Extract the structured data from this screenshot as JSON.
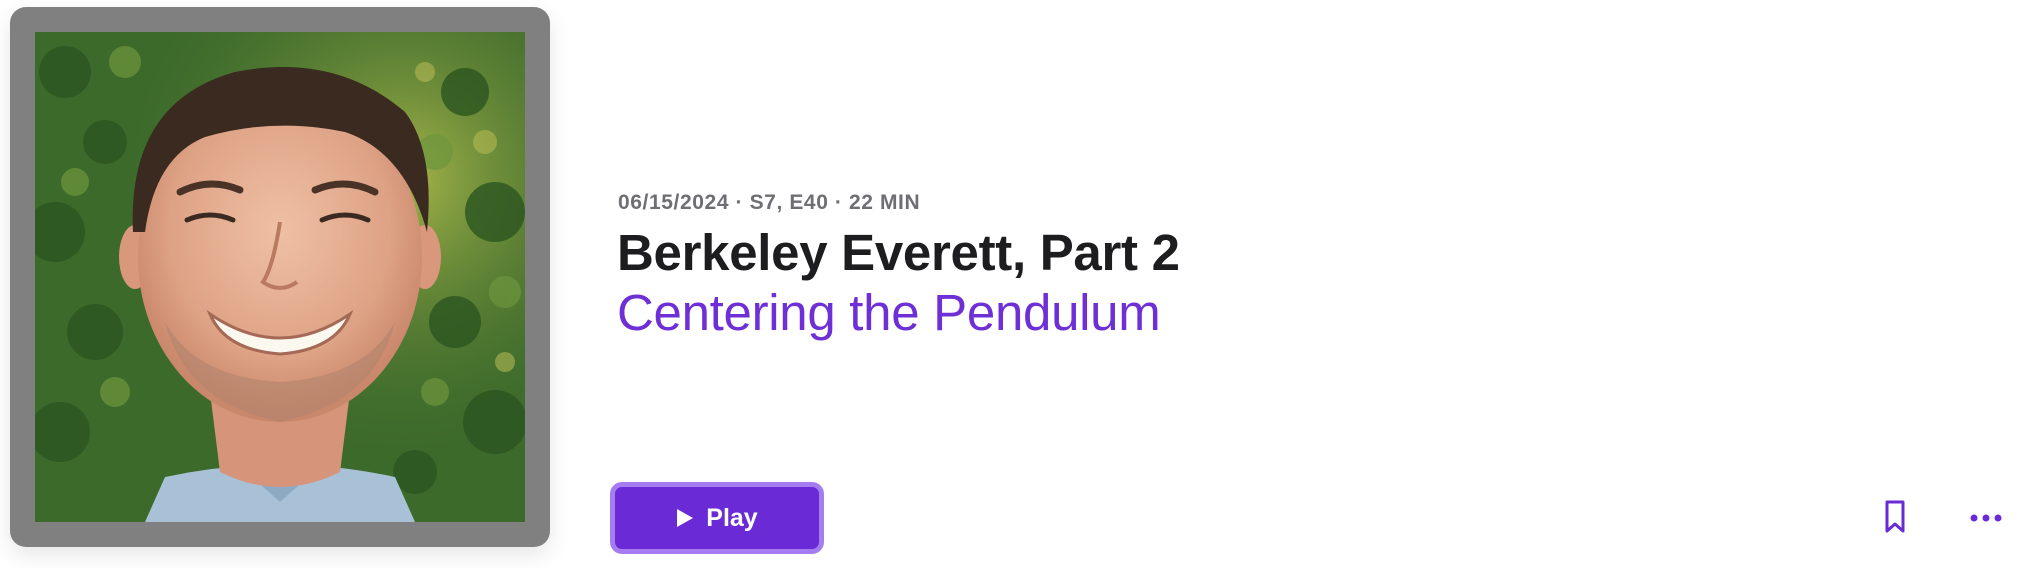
{
  "episode": {
    "date": "06/15/2024",
    "season_episode": "S7, E40",
    "duration": "22 MIN",
    "meta_line": "06/15/2024 · S7, E40 · 22 MIN",
    "title": "Berkeley Everett, Part 2",
    "show_title": "Centering the Pendulum"
  },
  "actions": {
    "play_label": "Play",
    "play_icon": "play-icon",
    "bookmark_icon": "bookmark-icon",
    "more_icon": "more-ellipsis-icon"
  },
  "colors": {
    "accent": "#6a2bd6",
    "show_title": "#6f2fd6",
    "meta": "#6e6e73",
    "title": "#1d1d1f"
  }
}
